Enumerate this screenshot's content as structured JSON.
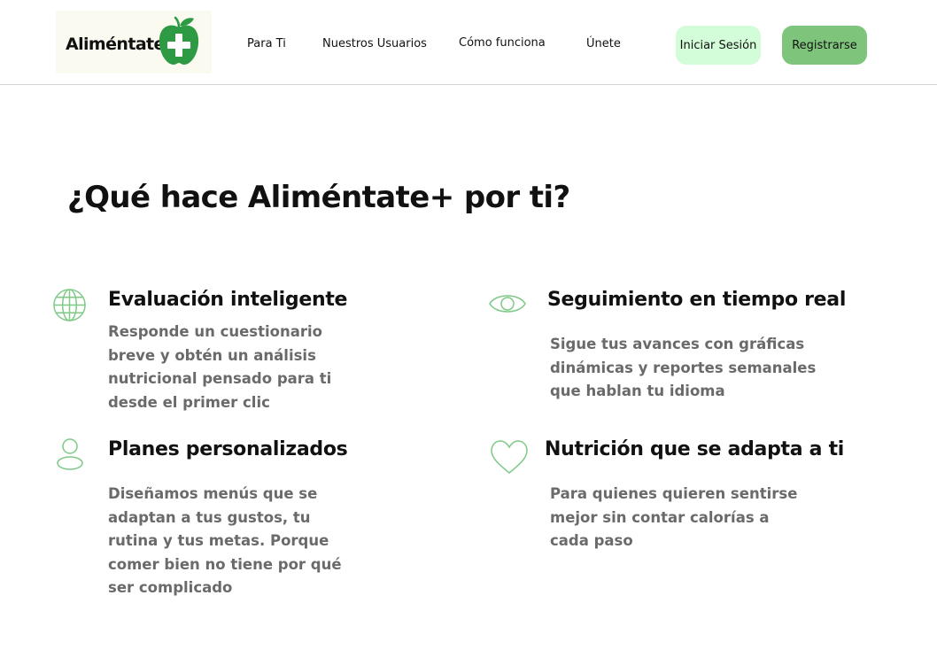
{
  "brand": {
    "name": "Aliméntate",
    "accent": "#2e9a44",
    "icon": "apple-plus-icon"
  },
  "nav": {
    "items": [
      {
        "label": "Para Ti"
      },
      {
        "label": "Nuestros Usuarios"
      },
      {
        "label": "Cómo funciona"
      },
      {
        "label": "Únete"
      }
    ],
    "login_label": "Iniciar Sesión",
    "register_label": "Registrarse"
  },
  "colors": {
    "login_bg": "#d3fcd8",
    "register_bg": "#7ec47a",
    "icon_stroke": "#7dc985",
    "description_text": "#6a6a6a"
  },
  "main": {
    "title": "¿Qué hace Aliméntate+ por ti?",
    "features": [
      {
        "icon": "globe-icon",
        "title": "Evaluación inteligente",
        "lines": [
          "Responde un cuestionario",
          "breve y obtén un análisis",
          "nutricional pensado para ti",
          "desde el primer clic"
        ]
      },
      {
        "icon": "eye-icon",
        "title": "Seguimiento en tiempo real",
        "lines": [
          "Sigue tus avances con gráficas",
          "dinámicas y reportes semanales",
          "que hablan tu idioma"
        ]
      },
      {
        "icon": "user-icon",
        "title": "Planes personalizados",
        "lines": [
          "Diseñamos menús que se",
          "adaptan a tus gustos, tu",
          "rutina y tus metas. Porque",
          "comer bien no tiene por qué",
          "ser complicado"
        ]
      },
      {
        "icon": "heart-icon",
        "title": "Nutrición que se adapta a ti",
        "lines": [
          "Para quienes quieren sentirse",
          "mejor sin contar calorías a",
          "cada paso"
        ]
      }
    ]
  }
}
